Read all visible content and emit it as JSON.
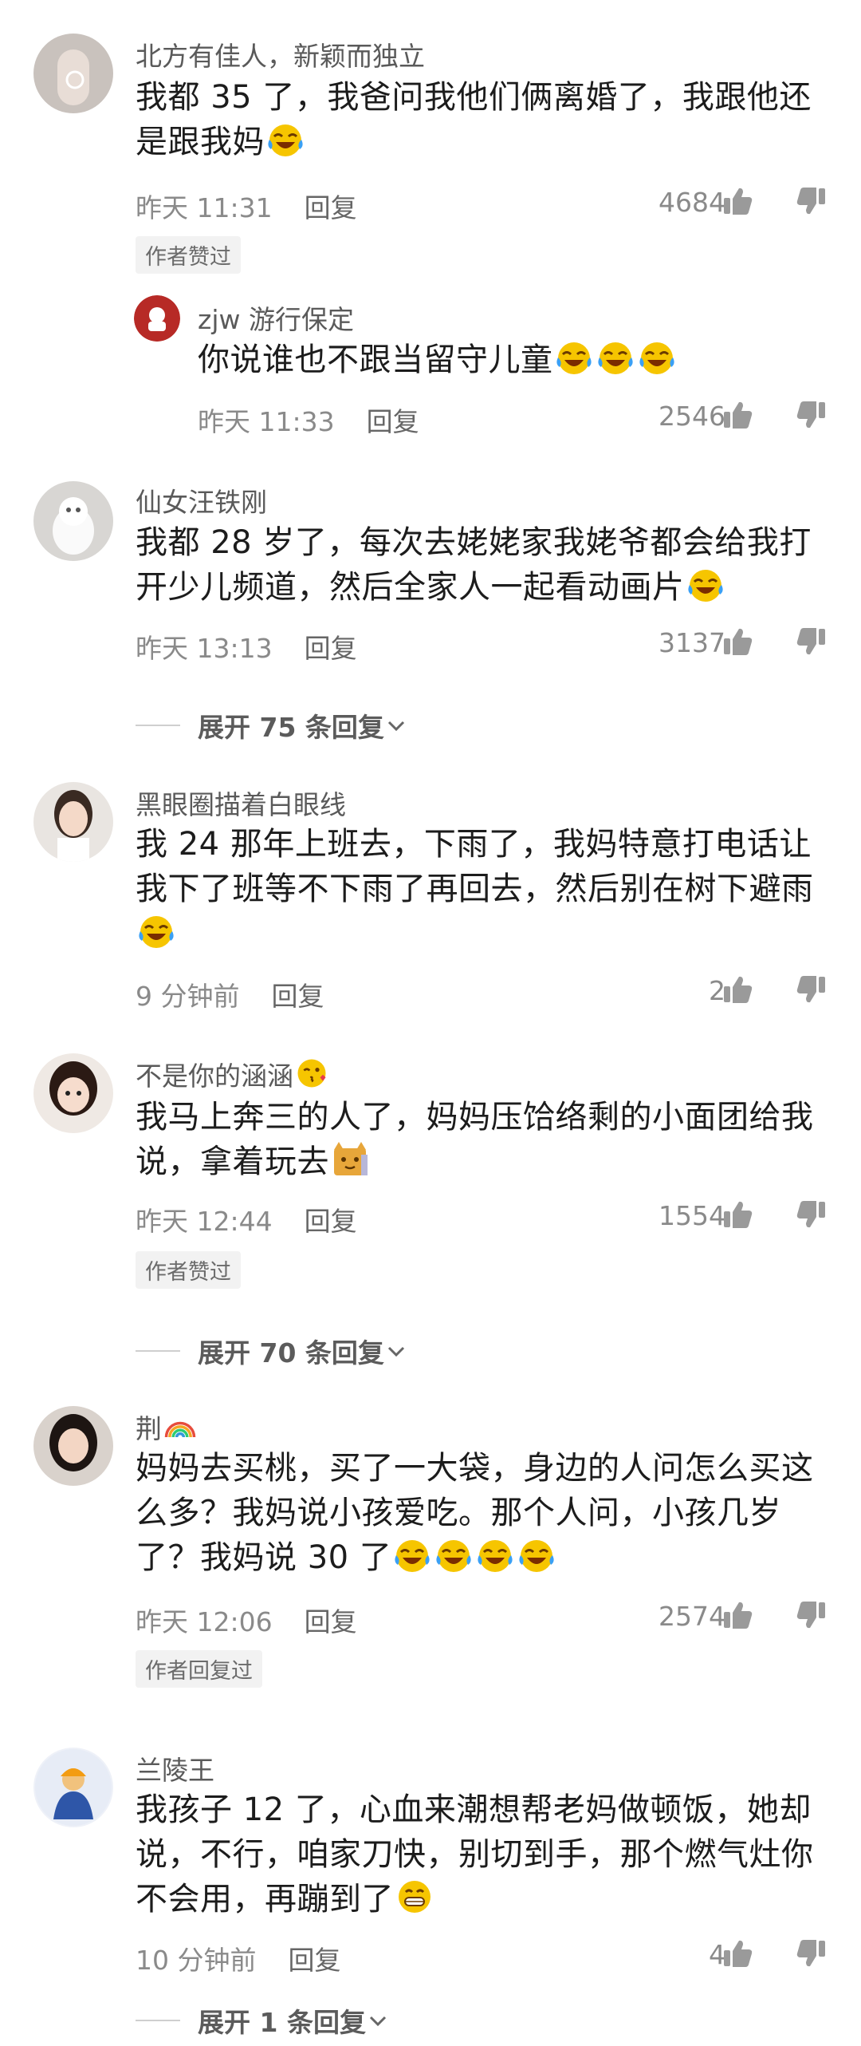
{
  "comments": [
    {
      "user": "北方有佳人，新颖而独立",
      "text": "我都 35 了，我爸问我他们俩离婚了，我跟他还是跟我妈",
      "time": "昨天 11:31",
      "reply_label": "回复",
      "likes": "4684",
      "badge": "作者赞过",
      "reply": {
        "user": "zjw 游行保定",
        "text": "你说谁也不跟当留守儿童",
        "time": "昨天 11:33",
        "reply_label": "回复",
        "likes": "2546"
      }
    },
    {
      "user": "仙女汪铁刚",
      "text": "我都 28 岁了，每次去姥姥家我姥爷都会给我打开少儿频道，然后全家人一起看动画片",
      "time": "昨天 13:13",
      "reply_label": "回复",
      "likes": "3137",
      "expand": "展开 75 条回复"
    },
    {
      "user": "黑眼圈描着白眼线",
      "text": "我 24 那年上班去，下雨了，我妈特意打电话让我下了班等不下雨了再回去，然后别在树下避雨",
      "time": "9 分钟前",
      "reply_label": "回复",
      "likes": "2"
    },
    {
      "user": "不是你的涵涵",
      "text": "我马上奔三的人了，妈妈压饸络剩的小面团给我说，拿着玩去",
      "time": "昨天 12:44",
      "reply_label": "回复",
      "likes": "1554",
      "badge": "作者赞过",
      "expand": "展开 70 条回复"
    },
    {
      "user": "荆",
      "text": "妈妈去买桃，买了一大袋，身边的人问怎么买这么多？我妈说小孩爱吃。那个人问，小孩几岁了？我妈说 30 了",
      "time": "昨天 12:06",
      "reply_label": "回复",
      "likes": "2574",
      "badge": "作者回复过"
    },
    {
      "user": "兰陵王",
      "text": "我孩子 12 了，心血来潮想帮老妈做顿饭，她却说，不行，咱家刀快，别切到手，那个燃气灶你不会用，再蹦到了",
      "time": "10 分钟前",
      "reply_label": "回复",
      "likes": "4",
      "expand": "展开 1 条回复"
    }
  ],
  "colors": {
    "text": "#1c1c1c",
    "meta": "#8a8a8a",
    "username": "#5a5a5a",
    "badge_bg": "#f2f2f2",
    "emoji": "#f5c400"
  },
  "icons": [
    "thumbs-up-icon",
    "thumbs-down-icon",
    "chevron-down-icon",
    "laughing-crying-emoji",
    "kiss-emoji",
    "cat-emoji",
    "rainbow-emoji",
    "grin-emoji"
  ]
}
